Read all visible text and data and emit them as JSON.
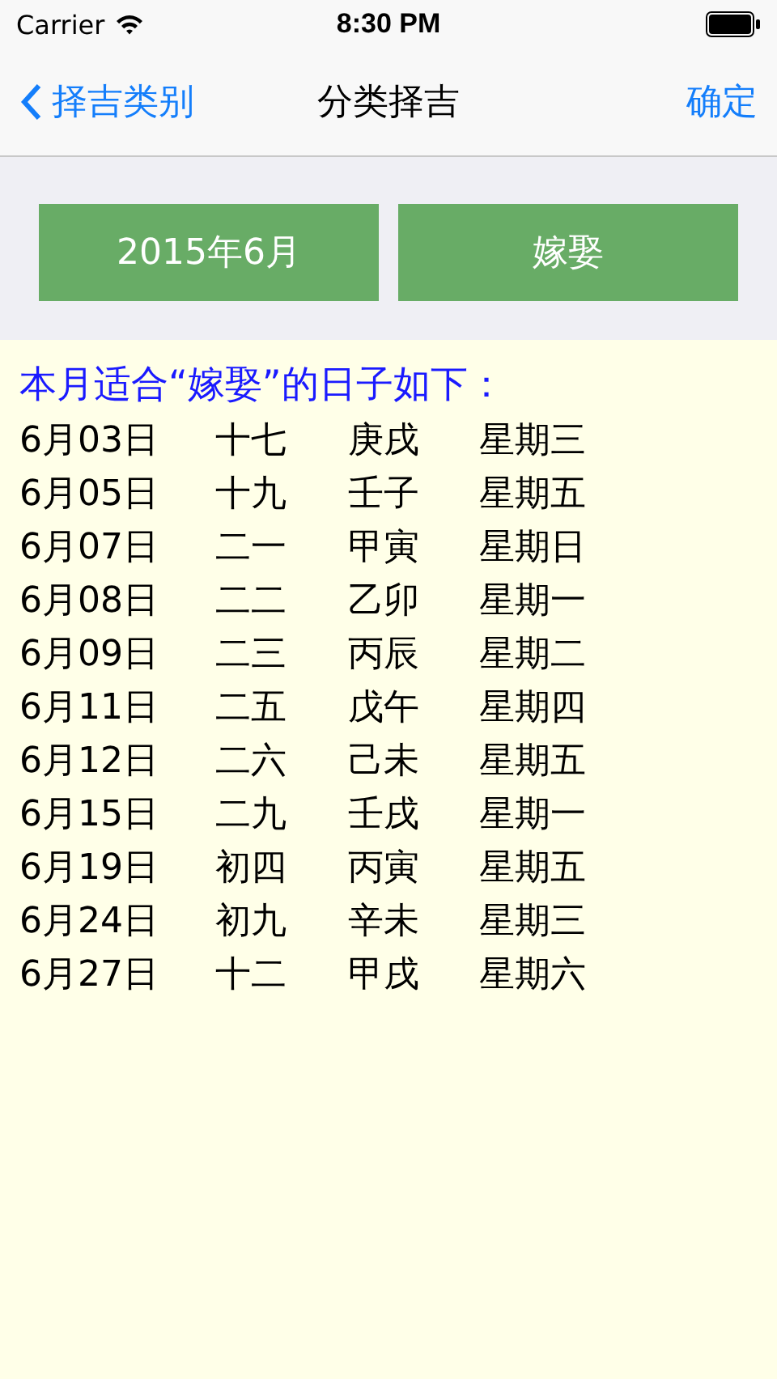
{
  "status_bar": {
    "carrier": "Carrier",
    "time": "8:30 PM"
  },
  "nav_bar": {
    "back_label": "择吉类别",
    "title": "分类择吉",
    "action": "确定"
  },
  "selectors": [
    {
      "label": "2015年6月"
    },
    {
      "label": "嫁娶"
    }
  ],
  "result": {
    "heading": "本月适合“嫁娶”的日子如下：",
    "rows": [
      {
        "date": "6月03日",
        "lunar_day": "十七",
        "ganzhi": "庚戌",
        "weekday": "星期三"
      },
      {
        "date": "6月05日",
        "lunar_day": "十九",
        "ganzhi": "壬子",
        "weekday": "星期五"
      },
      {
        "date": "6月07日",
        "lunar_day": "二一",
        "ganzhi": "甲寅",
        "weekday": "星期日"
      },
      {
        "date": "6月08日",
        "lunar_day": "二二",
        "ganzhi": "乙卯",
        "weekday": "星期一"
      },
      {
        "date": "6月09日",
        "lunar_day": "二三",
        "ganzhi": "丙辰",
        "weekday": "星期二"
      },
      {
        "date": "6月11日",
        "lunar_day": "二五",
        "ganzhi": "戊午",
        "weekday": "星期四"
      },
      {
        "date": "6月12日",
        "lunar_day": "二六",
        "ganzhi": "己未",
        "weekday": "星期五"
      },
      {
        "date": "6月15日",
        "lunar_day": "二九",
        "ganzhi": "壬戌",
        "weekday": "星期一"
      },
      {
        "date": "6月19日",
        "lunar_day": "初四",
        "ganzhi": "丙寅",
        "weekday": "星期五"
      },
      {
        "date": "6月24日",
        "lunar_day": "初九",
        "ganzhi": "辛未",
        "weekday": "星期三"
      },
      {
        "date": "6月27日",
        "lunar_day": "十二",
        "ganzhi": "甲戌",
        "weekday": "星期六"
      }
    ]
  }
}
